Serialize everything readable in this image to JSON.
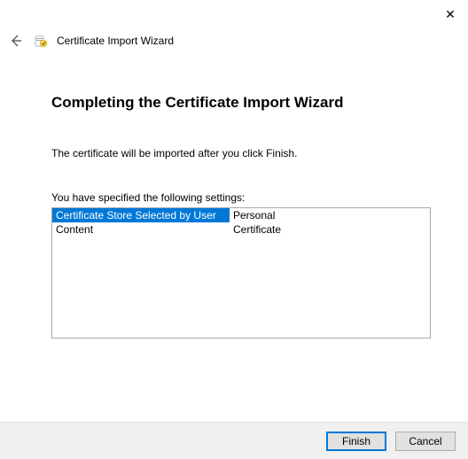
{
  "window": {
    "title": "Certificate Import Wizard"
  },
  "page": {
    "heading": "Completing the Certificate Import Wizard",
    "info": "The certificate will be imported after you click Finish.",
    "settings_label": "You have specified the following settings:",
    "rows": [
      {
        "label": "Certificate Store Selected by User",
        "value": "Personal",
        "selected": true
      },
      {
        "label": "Content",
        "value": "Certificate",
        "selected": false
      }
    ]
  },
  "buttons": {
    "finish": "Finish",
    "cancel": "Cancel"
  }
}
